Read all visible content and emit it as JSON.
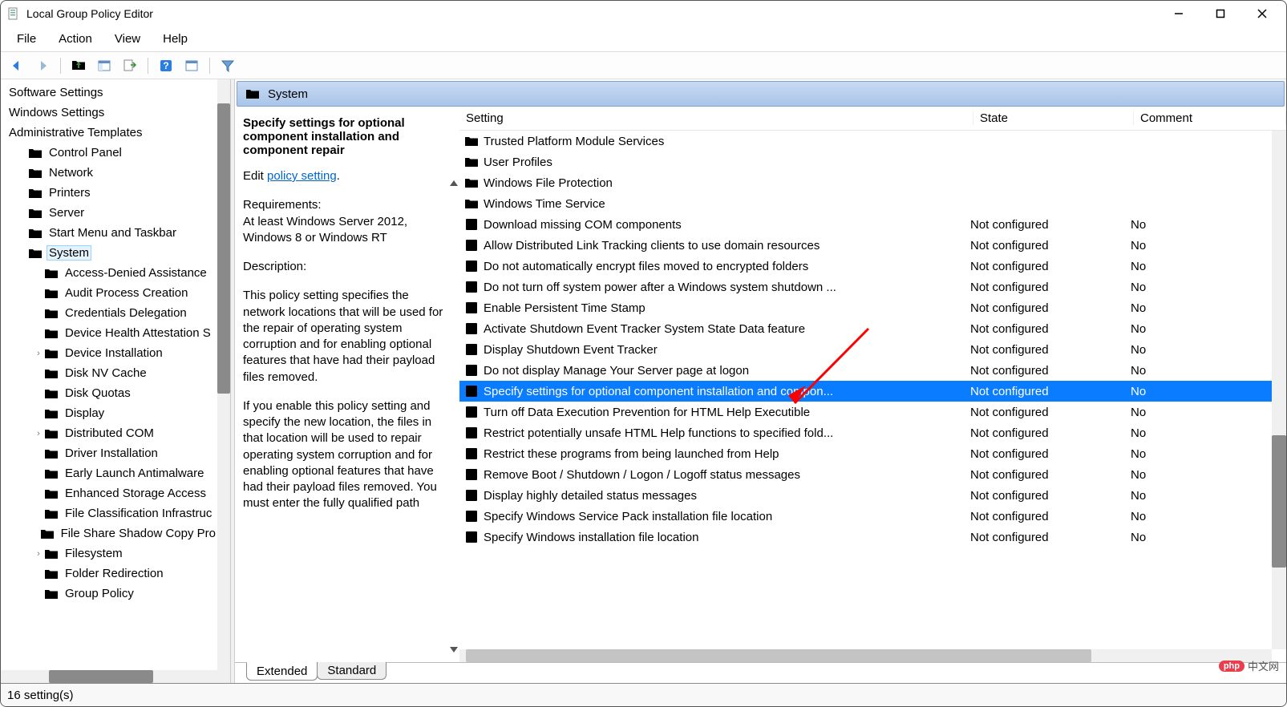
{
  "window": {
    "title": "Local Group Policy Editor"
  },
  "menubar": [
    "File",
    "Action",
    "View",
    "Help"
  ],
  "tree": {
    "top": [
      {
        "label": "Software Settings",
        "depth": 0,
        "icon": false
      },
      {
        "label": "Windows Settings",
        "depth": 0,
        "icon": false
      },
      {
        "label": "Administrative Templates",
        "depth": 0,
        "icon": false
      }
    ],
    "items": [
      {
        "label": "Control Panel",
        "depth": 1,
        "expander": ""
      },
      {
        "label": "Network",
        "depth": 1,
        "expander": ""
      },
      {
        "label": "Printers",
        "depth": 1,
        "expander": ""
      },
      {
        "label": "Server",
        "depth": 1,
        "expander": ""
      },
      {
        "label": "Start Menu and Taskbar",
        "depth": 1,
        "expander": ""
      },
      {
        "label": "System",
        "depth": 1,
        "expander": "",
        "selected": true
      },
      {
        "label": "Access-Denied Assistance",
        "depth": 2,
        "expander": ""
      },
      {
        "label": "Audit Process Creation",
        "depth": 2,
        "expander": ""
      },
      {
        "label": "Credentials Delegation",
        "depth": 2,
        "expander": ""
      },
      {
        "label": "Device Health Attestation S",
        "depth": 2,
        "expander": ""
      },
      {
        "label": "Device Installation",
        "depth": 2,
        "expander": "›"
      },
      {
        "label": "Disk NV Cache",
        "depth": 2,
        "expander": ""
      },
      {
        "label": "Disk Quotas",
        "depth": 2,
        "expander": ""
      },
      {
        "label": "Display",
        "depth": 2,
        "expander": ""
      },
      {
        "label": "Distributed COM",
        "depth": 2,
        "expander": "›"
      },
      {
        "label": "Driver Installation",
        "depth": 2,
        "expander": ""
      },
      {
        "label": "Early Launch Antimalware",
        "depth": 2,
        "expander": ""
      },
      {
        "label": "Enhanced Storage Access",
        "depth": 2,
        "expander": ""
      },
      {
        "label": "File Classification Infrastruc",
        "depth": 2,
        "expander": ""
      },
      {
        "label": "File Share Shadow Copy Pro",
        "depth": 2,
        "expander": ""
      },
      {
        "label": "Filesystem",
        "depth": 2,
        "expander": "›"
      },
      {
        "label": "Folder Redirection",
        "depth": 2,
        "expander": ""
      },
      {
        "label": "Group Policy",
        "depth": 2,
        "expander": ""
      }
    ]
  },
  "right": {
    "header": "System",
    "detail": {
      "title": "Specify settings for optional component installation and component repair",
      "edit_prefix": "Edit ",
      "edit_link": "policy setting",
      "req_label": "Requirements:",
      "req_text": "At least Windows Server 2012, Windows 8 or Windows RT",
      "desc_label": "Description:",
      "desc_p1": "This policy setting specifies the network locations that will be used for the repair of operating system corruption and for enabling optional features that have had their payload files removed.",
      "desc_p2": "If you enable this policy setting and specify the new location, the files in that location will be used to repair operating system corruption and for enabling optional features that have had their payload files removed. You must enter the fully qualified path"
    },
    "columns": {
      "setting": "Setting",
      "state": "State",
      "comment": "Comment"
    },
    "rows": [
      {
        "type": "folder",
        "name": "Trusted Platform Module Services",
        "state": "",
        "comment": ""
      },
      {
        "type": "folder",
        "name": "User Profiles",
        "state": "",
        "comment": ""
      },
      {
        "type": "folder",
        "name": "Windows File Protection",
        "state": "",
        "comment": ""
      },
      {
        "type": "folder",
        "name": "Windows Time Service",
        "state": "",
        "comment": ""
      },
      {
        "type": "setting",
        "name": "Download missing COM components",
        "state": "Not configured",
        "comment": "No"
      },
      {
        "type": "setting",
        "name": "Allow Distributed Link Tracking clients to use domain resources",
        "state": "Not configured",
        "comment": "No"
      },
      {
        "type": "setting",
        "name": "Do not automatically encrypt files moved to encrypted folders",
        "state": "Not configured",
        "comment": "No"
      },
      {
        "type": "setting",
        "name": "Do not turn off system power after a Windows system shutdown ...",
        "state": "Not configured",
        "comment": "No"
      },
      {
        "type": "setting",
        "name": "Enable Persistent Time Stamp",
        "state": "Not configured",
        "comment": "No"
      },
      {
        "type": "setting",
        "name": "Activate Shutdown Event Tracker System State Data feature",
        "state": "Not configured",
        "comment": "No"
      },
      {
        "type": "setting",
        "name": "Display Shutdown Event Tracker",
        "state": "Not configured",
        "comment": "No"
      },
      {
        "type": "setting",
        "name": "Do not display Manage Your Server page at logon",
        "state": "Not configured",
        "comment": "No"
      },
      {
        "type": "setting",
        "name": "Specify settings for optional component installation and compon...",
        "state": "Not configured",
        "comment": "No",
        "selected": true
      },
      {
        "type": "setting",
        "name": "Turn off Data Execution Prevention for HTML Help Executible",
        "state": "Not configured",
        "comment": "No"
      },
      {
        "type": "setting",
        "name": "Restrict potentially unsafe HTML Help functions to specified fold...",
        "state": "Not configured",
        "comment": "No"
      },
      {
        "type": "setting",
        "name": "Restrict these programs from being launched from Help",
        "state": "Not configured",
        "comment": "No"
      },
      {
        "type": "setting",
        "name": "Remove Boot / Shutdown / Logon / Logoff status messages",
        "state": "Not configured",
        "comment": "No"
      },
      {
        "type": "setting",
        "name": "Display highly detailed status messages",
        "state": "Not configured",
        "comment": "No"
      },
      {
        "type": "setting",
        "name": "Specify Windows Service Pack installation file location",
        "state": "Not configured",
        "comment": "No"
      },
      {
        "type": "setting",
        "name": "Specify Windows installation file location",
        "state": "Not configured",
        "comment": "No"
      }
    ],
    "tabs": {
      "extended": "Extended",
      "standard": "Standard"
    }
  },
  "statusbar": "16 setting(s)",
  "watermark": "中文网"
}
